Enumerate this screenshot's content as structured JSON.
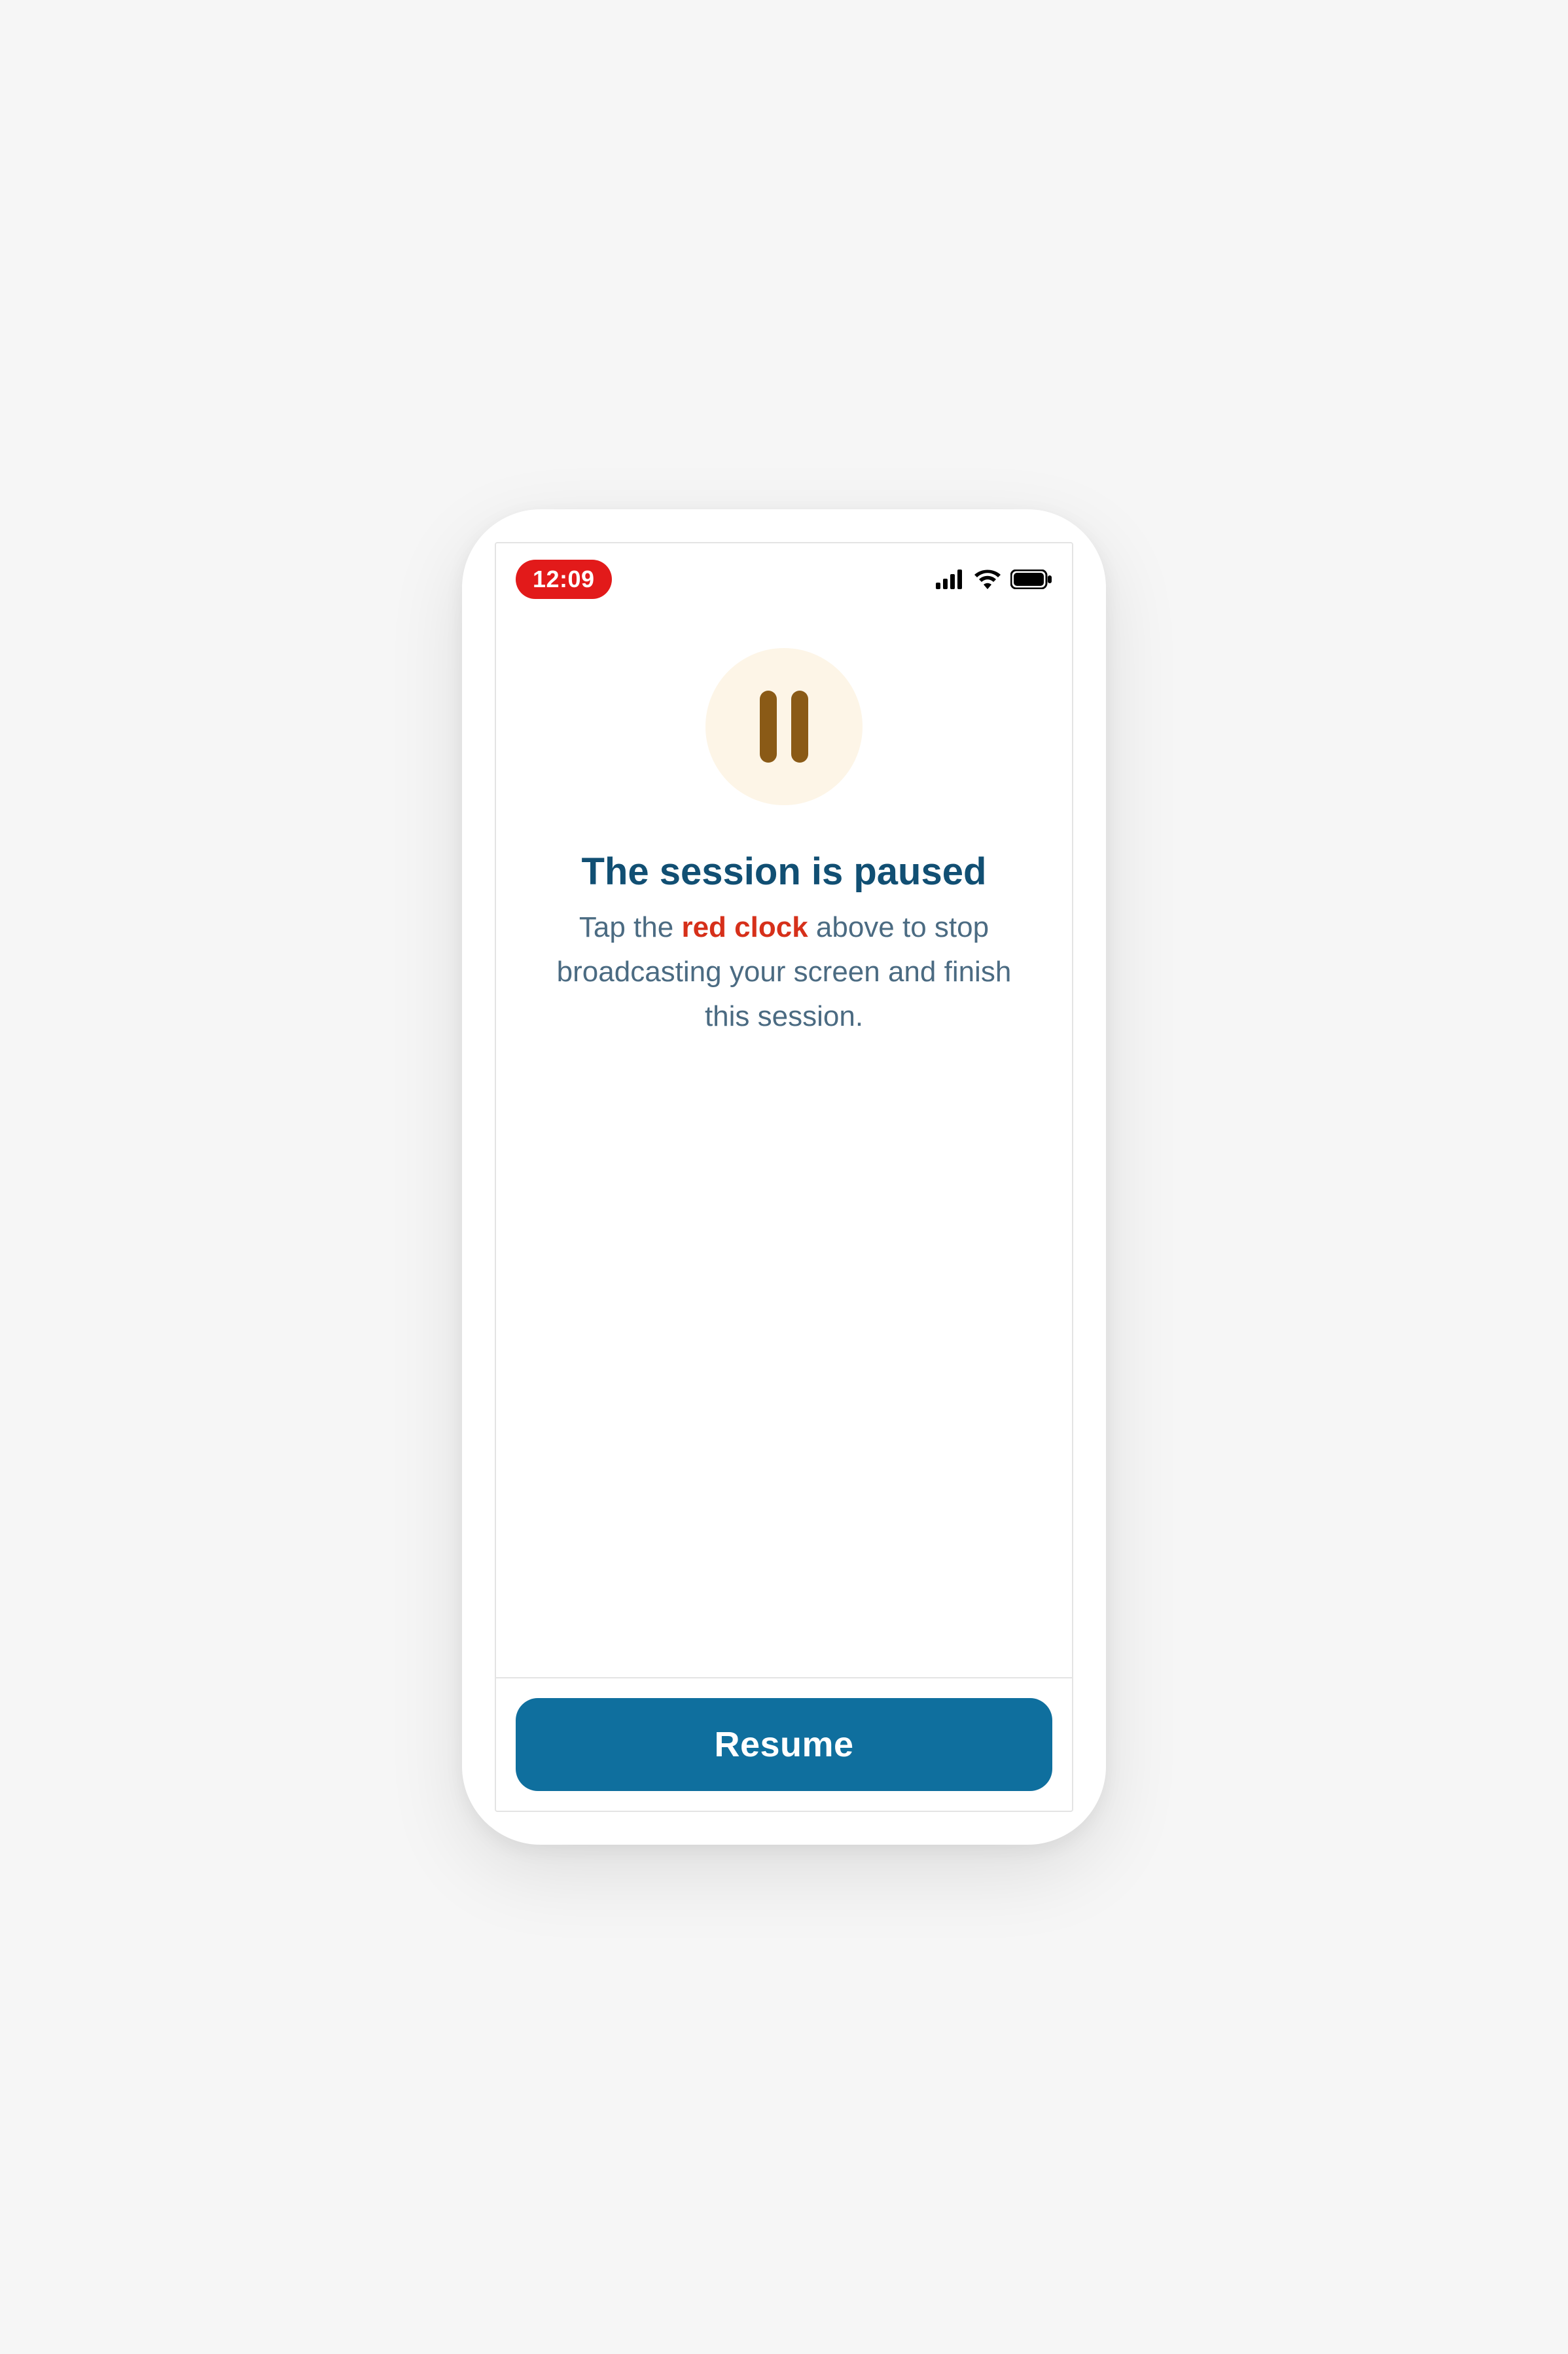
{
  "status_bar": {
    "time": "12:09"
  },
  "pause_screen": {
    "title": "The session is paused",
    "description_pre": "Tap the ",
    "description_highlight": "red clock",
    "description_post": " above to stop broadcasting your screen and finish this session."
  },
  "footer": {
    "resume_label": "Resume"
  },
  "colors": {
    "accent": "#0f6f9e",
    "recording_red": "#e21a1a",
    "highlight_red": "#d6301a",
    "title_blue": "#114f73",
    "body_blue_gray": "#4b6b82",
    "pause_bg": "#fdf5e7",
    "pause_bar": "#8a5a16"
  }
}
